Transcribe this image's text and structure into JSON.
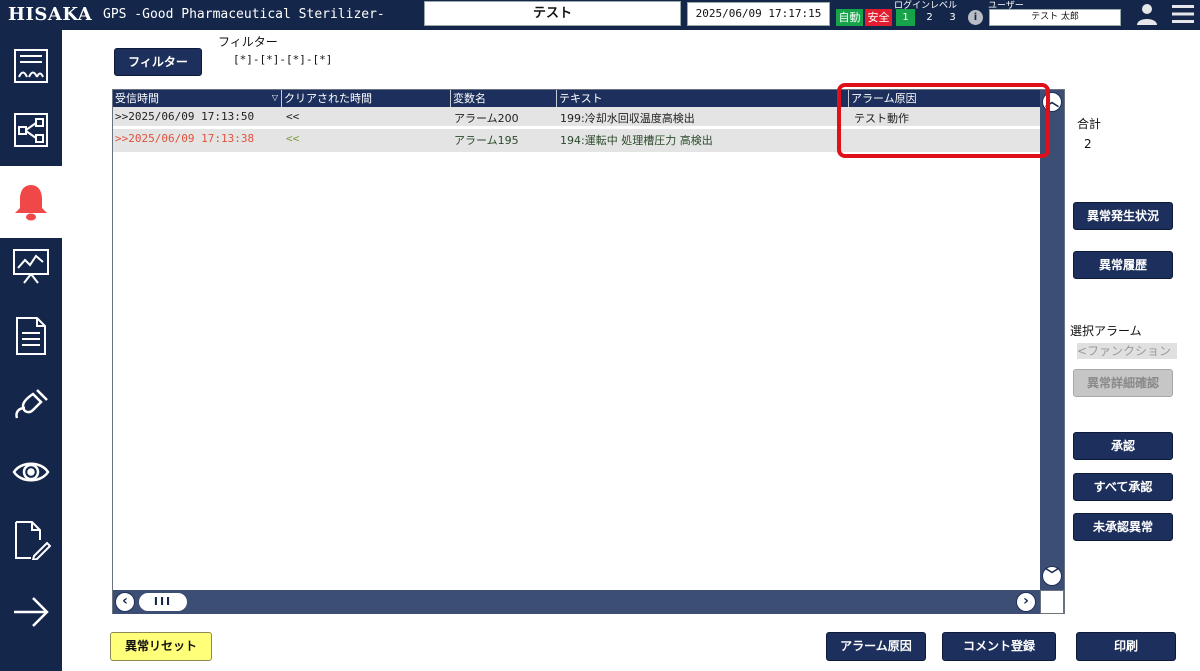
{
  "header": {
    "logo": "HISAKA",
    "app_title": "GPS -Good Pharmaceutical Sterilizer-",
    "title_box": "テスト",
    "datetime": "2025/06/09  17:17:15",
    "auto_badge": "自動",
    "safe_badge": "安全",
    "login_level_label": "ログインレベル",
    "levels": [
      "1",
      "2",
      "3"
    ],
    "active_level": "1",
    "user_label": "ユーザー",
    "user_name": "テスト 太郎",
    "colors": {
      "bar": "#14264a",
      "auto": "#16a34a",
      "safe": "#e11d2f"
    }
  },
  "sidebar": {
    "items": [
      {
        "icon": "dashboard-icon"
      },
      {
        "icon": "network-icon"
      },
      {
        "icon": "bell-icon",
        "active": true
      },
      {
        "icon": "trend-chart-icon"
      },
      {
        "icon": "document-icon"
      },
      {
        "icon": "plug-icon"
      },
      {
        "icon": "eye-icon"
      },
      {
        "icon": "edit-document-icon"
      },
      {
        "icon": "arrow-right-icon"
      }
    ]
  },
  "filter": {
    "button_label": "フィルター",
    "label": "フィルター",
    "value": "[*]-[*]-[*]-[*]"
  },
  "table": {
    "columns": [
      "受信時間",
      "クリアされた時間",
      "変数名",
      "テキスト",
      "アラーム原因"
    ],
    "rows": [
      {
        "received": ">>2025/06/09 17:13:50",
        "cleared": "<<",
        "variable": "アラーム200",
        "text": "199:冷却水回収温度高検出",
        "cause": "テスト動作"
      },
      {
        "received": ">>2025/06/09 17:13:38",
        "cleared": "<<",
        "variable": "アラーム195",
        "text": "194:運転中 処理槽圧力 高検出",
        "cause": ""
      }
    ],
    "hscroll_thumb": "III"
  },
  "right_panel": {
    "total_label": "合計",
    "total_value": "2",
    "occurrence_button": "異常発生状況",
    "history_button": "異常履歴",
    "selected_alarm_label": "選択アラーム",
    "function_field": "<ファンクション",
    "detail_button": "異常詳細確認",
    "acknowledge_button": "承認",
    "acknowledge_all_button": "すべて承認",
    "unacknowledged_button": "未承認異常"
  },
  "bottom": {
    "reset_button": "異常リセット",
    "cause_button": "アラーム原因",
    "comment_button": "コメント登録",
    "print_button": "印刷"
  },
  "accent_colors": {
    "highlight": "#e0101a",
    "reset_button": "#ffff7a",
    "active_nav_icon": "#f04848"
  }
}
